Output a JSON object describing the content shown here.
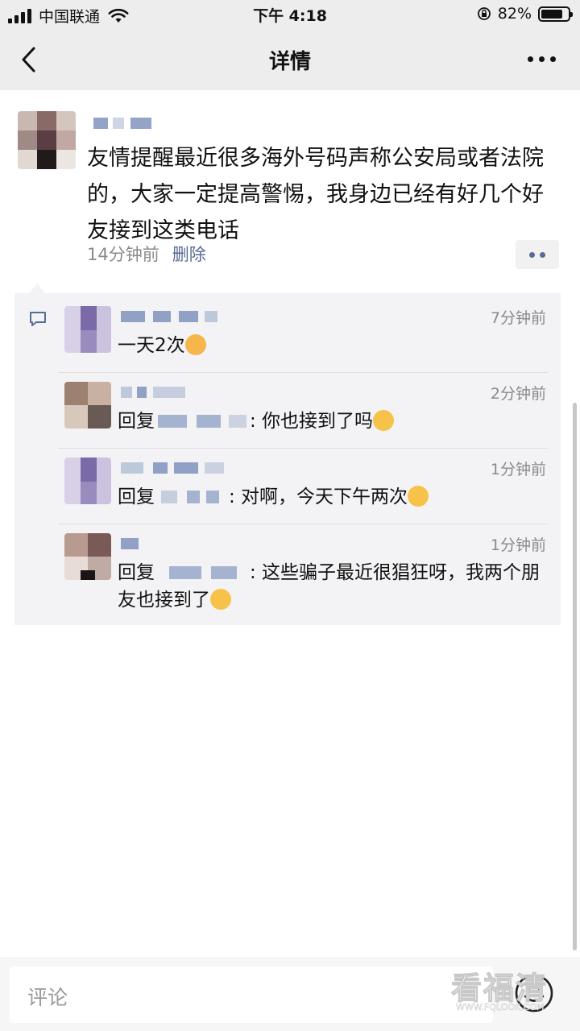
{
  "status_bar": {
    "carrier": "中国联通",
    "time": "下午 4:18",
    "battery_percent": "82%",
    "battery_level": 0.82
  },
  "nav": {
    "title": "详情",
    "back_icon": "chevron-left-icon",
    "more_icon": "more-horizontal-icon"
  },
  "post": {
    "text": "友情提醒最近很多海外号码声称公安局或者法院的，大家一定提高警惕，我身边已经有好几个好友接到这类电话",
    "time": "14分钟前",
    "delete_label": "删除"
  },
  "comments": [
    {
      "time": "7分钟前",
      "text": "一天2次",
      "emoji": "astonished-emoji-icon"
    },
    {
      "time": "2分钟前",
      "reply_prefix": "回复",
      "text": ": 你也接到了吗",
      "emoji": "tears-of-joy-emoji-icon"
    },
    {
      "time": "1分钟前",
      "reply_prefix": "回复",
      "text": ": 对啊，今天下午两次",
      "emoji": "rofl-emoji-icon"
    },
    {
      "time": "1分钟前",
      "reply_prefix": "回复",
      "text": ": 这些骗子最近很猖狂呀，我两个朋友也接到了",
      "emoji": "rofl-emoji-icon"
    }
  ],
  "comment_input": {
    "placeholder": "评论",
    "emoji_icon": "smile-icon"
  },
  "watermark": {
    "text": "看福清",
    "url": "WWW.FQLOOK.COM"
  },
  "colors": {
    "link": "#576b95",
    "meta": "#8a8a8a",
    "panel": "#f3f3f5",
    "bar": "#ededed"
  }
}
